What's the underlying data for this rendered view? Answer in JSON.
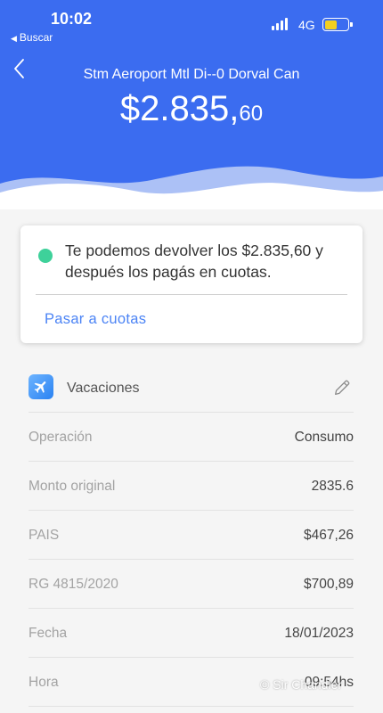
{
  "status_bar": {
    "time": "10:02",
    "back_app": "Buscar",
    "network": "4G",
    "battery_level": 0.55
  },
  "header": {
    "merchant": "Stm Aeroport Mtl Di--0 Dorval Can",
    "amount_main": "$2.835,",
    "amount_cents": "60",
    "color": "#3b6cf0"
  },
  "offer_card": {
    "message": "Te podemos devolver los $2.835,60 y después los pagás en cuotas.",
    "cta": "Pasar a cuotas",
    "dot_color": "#3ed19a",
    "cta_color": "#4c84f5"
  },
  "category": {
    "icon": "airplane-icon",
    "label": "Vacaciones"
  },
  "details": [
    {
      "label": "Operación",
      "value": "Consumo"
    },
    {
      "label": "Monto original",
      "value": "2835.6"
    },
    {
      "label": "PAIS",
      "value": "$467,26"
    },
    {
      "label": "RG 4815/2020",
      "value": "$700,89"
    },
    {
      "label": "Fecha",
      "value": "18/01/2023"
    },
    {
      "label": "Hora",
      "value": "09:54hs"
    }
  ],
  "watermark": "© Sir Chandler"
}
